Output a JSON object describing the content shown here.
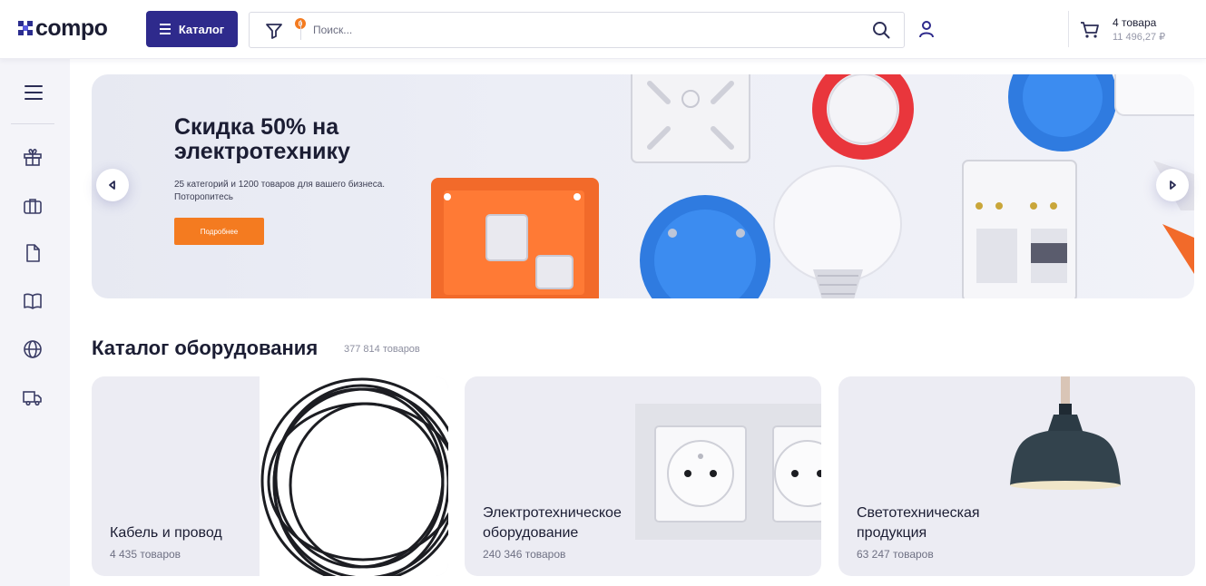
{
  "header": {
    "logo_text": "compo",
    "catalog_label": "Каталог",
    "filter_badge": "0",
    "search_placeholder": "Поиск...",
    "cart": {
      "count_label": "4 товара",
      "total_label": "11 496,27 ₽"
    }
  },
  "sidebar": {
    "items": [
      {
        "icon": "gift-icon"
      },
      {
        "icon": "briefcase-icon"
      },
      {
        "icon": "document-icon"
      },
      {
        "icon": "book-icon"
      },
      {
        "icon": "globe-icon"
      },
      {
        "icon": "truck-icon"
      }
    ]
  },
  "banner": {
    "title": "Скидка 50% на электротехнику",
    "subtitle": "25 категорий и 1200 товаров для вашего бизнеса. Поторопитесь",
    "button_label": "Подробнее"
  },
  "catalog": {
    "title": "Каталог оборудования",
    "count_label": "377 814 товаров",
    "cards": [
      {
        "name": "Кабель и провод",
        "count": "4 435 товаров",
        "image": "cable-coil"
      },
      {
        "name": "Электротехническое оборудование",
        "count": "240 346 товаров",
        "image": "power-sockets"
      },
      {
        "name": "Светотехническая продукция",
        "count": "63 247 товаров",
        "image": "pendant-lamp"
      }
    ]
  },
  "colors": {
    "brand": "#2e2a8c",
    "accent": "#f47b20",
    "text": "#1b1d33",
    "muted": "#8c8e9f"
  }
}
